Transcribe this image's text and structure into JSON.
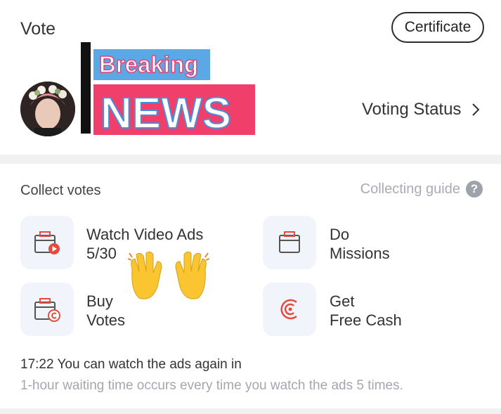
{
  "header": {
    "title": "Vote",
    "certificate_label": "Certificate",
    "voting_status_label": "Voting Status"
  },
  "sticker": {
    "line1": "Breaking",
    "line2": "NEWS"
  },
  "collect": {
    "heading": "Collect votes",
    "guide_label": "Collecting guide",
    "guide_icon": "?",
    "items": [
      {
        "line1": "Watch Video Ads",
        "line2": "5/30",
        "icon": "video-ad-icon"
      },
      {
        "line1": "Do",
        "line2": "Missions",
        "icon": "missions-icon"
      },
      {
        "line1": "Buy",
        "line2": "Votes",
        "icon": "buy-votes-icon"
      },
      {
        "line1": "Get",
        "line2": "Free Cash",
        "icon": "free-cash-icon"
      }
    ]
  },
  "ads_notice": {
    "line1": "17:22 You can watch the ads again in",
    "line2": "1-hour waiting time occurs every time you watch the ads 5 times."
  },
  "colors": {
    "accent_red": "#e64a3c",
    "tile_bg": "#f1f4fb",
    "muted_text": "#a3a7ad"
  }
}
